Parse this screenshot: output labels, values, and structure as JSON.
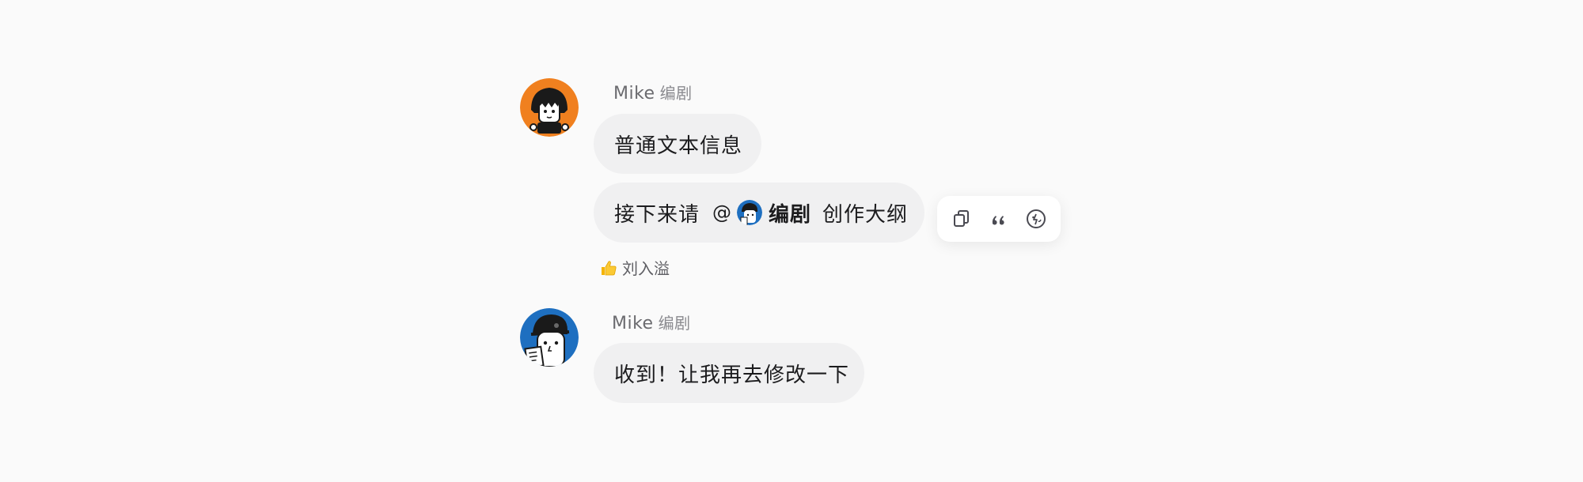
{
  "messages": [
    {
      "sender": "Mike",
      "role": "编剧",
      "bubbles": [
        {
          "text": "普通文本信息"
        },
        {
          "prefix": "接下来请",
          "mention_at": "@",
          "mention_name": "编剧",
          "suffix": "创作大纲"
        }
      ],
      "reaction": {
        "icon": "thumbs-up-icon",
        "user": "刘入溢"
      }
    },
    {
      "sender": "Mike",
      "role": "编剧",
      "bubbles": [
        {
          "text": "收到！让我再去修改一下"
        }
      ]
    }
  ],
  "toolbar": {
    "icons": [
      "copy-icon",
      "quote-icon",
      "emoji-reaction-icon"
    ]
  },
  "colors": {
    "background": "#fafafa",
    "bubble": "#f0f0f1",
    "avatar_orange": "#f0801f",
    "avatar_blue": "#1e6fc0"
  }
}
